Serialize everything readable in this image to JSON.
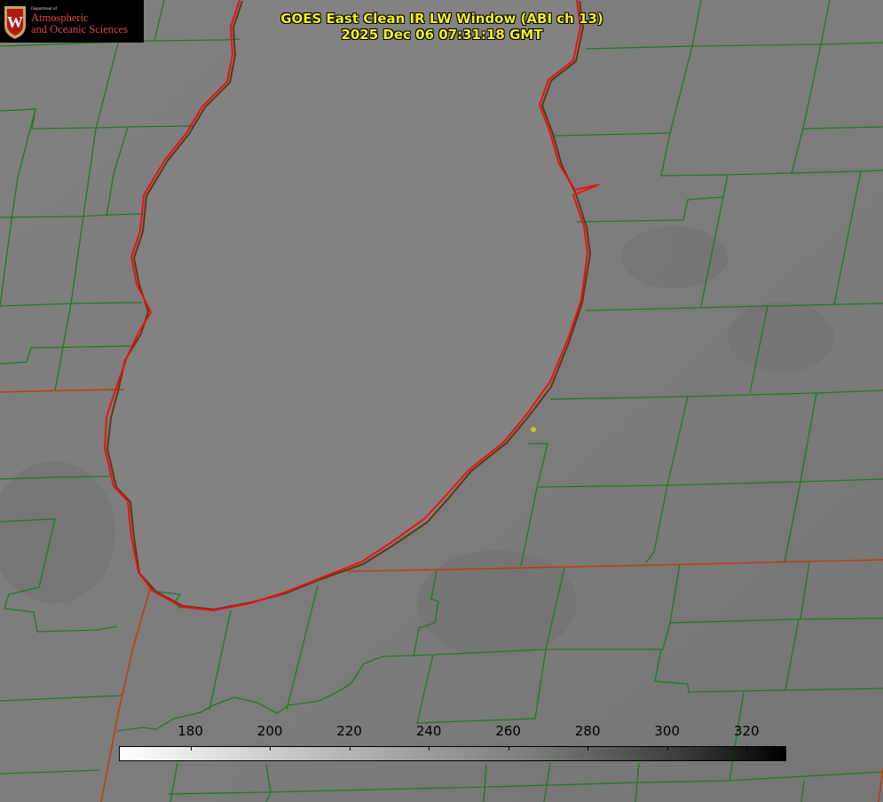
{
  "title": {
    "line1": "GOES East Clean IR LW Window (ABI ch 13)",
    "line2": "2025 Dec 06 07:31:18 GMT"
  },
  "logo": {
    "dept": "Department of",
    "line1": "Atmospheric",
    "line2": "and Oceanic Sciences",
    "seal_letter": "W"
  },
  "colorbar": {
    "min": 162,
    "max": 330,
    "ticks": [
      "180",
      "200",
      "220",
      "240",
      "260",
      "280",
      "300",
      "320"
    ]
  },
  "colors": {
    "county_lines": "#1e7a1e",
    "state_lines": "#b8400a",
    "lakeshore_outline": "#ee1010",
    "text": "#f2f21a",
    "marker": "#c8c820",
    "logo_red": "#e04848"
  },
  "marker_icon": "station-dot-icon"
}
